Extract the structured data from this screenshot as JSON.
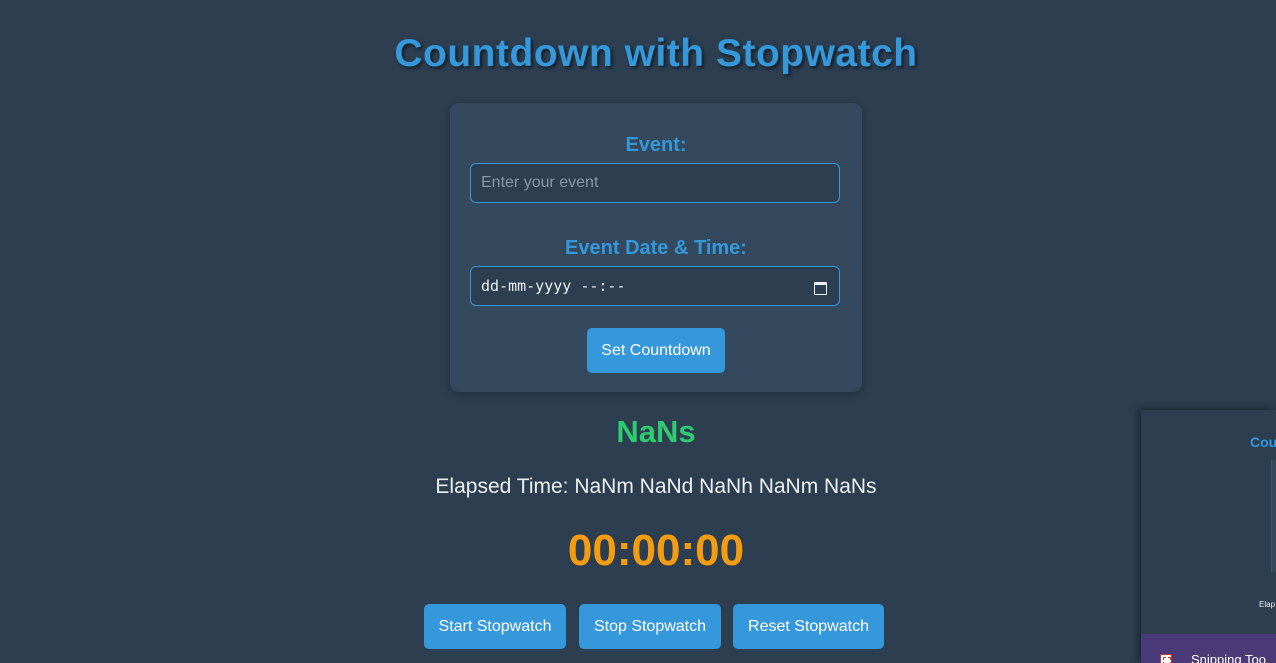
{
  "header": {
    "title": "Countdown with Stopwatch"
  },
  "form": {
    "event_label": "Event:",
    "event_placeholder": "Enter your event",
    "event_value": "",
    "datetime_label": "Event Date & Time:",
    "datetime_placeholder": "dd-mm-yyyy --:--",
    "set_button_label": "Set Countdown"
  },
  "countdown": {
    "display": "NaNs",
    "elapsed_text": "Elapsed Time: NaNm NaNd NaNh NaNm NaNs"
  },
  "stopwatch": {
    "display": "00:00:00",
    "start_label": "Start Stopwatch",
    "stop_label": "Stop Stopwatch",
    "reset_label": "Reset Stopwatch"
  },
  "preview": {
    "title_fragment": "Cou",
    "elapsed_fragment": "Elap",
    "app_label": "Snipping Too"
  },
  "colors": {
    "background": "#2c3e50",
    "card": "#34495e",
    "accent": "#3498db",
    "countdown": "#2ecc71",
    "stopwatch": "#f39c12"
  }
}
